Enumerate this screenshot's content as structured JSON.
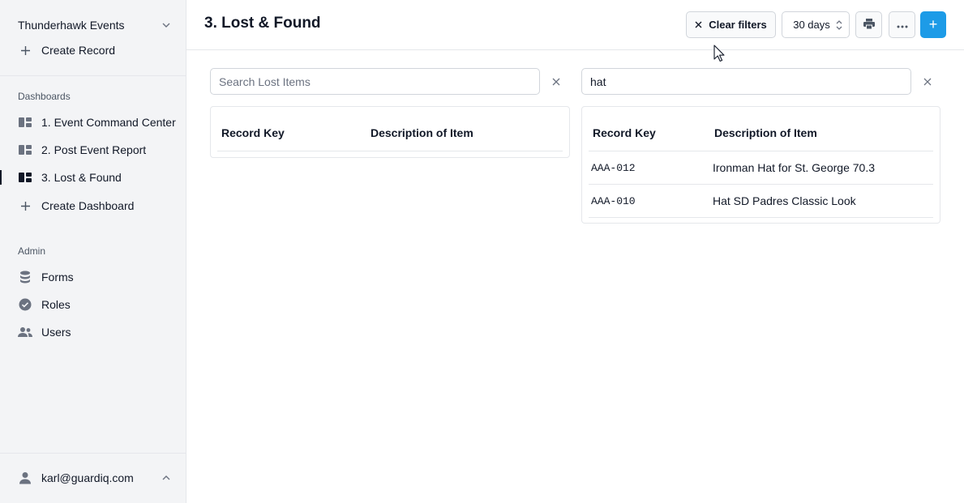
{
  "sidebar": {
    "org_name": "Thunderhawk Events",
    "create_record": "Create Record",
    "dashboards_label": "Dashboards",
    "dashboards": [
      {
        "label": "1. Event Command Center"
      },
      {
        "label": "2. Post Event Report"
      },
      {
        "label": "3. Lost & Found"
      }
    ],
    "create_dashboard": "Create Dashboard",
    "admin_label": "Admin",
    "admin_items": [
      {
        "label": "Forms",
        "icon": "database-icon"
      },
      {
        "label": "Roles",
        "icon": "check-badge-icon"
      },
      {
        "label": "Users",
        "icon": "users-icon"
      }
    ],
    "user_email": "karl@guardiq.com"
  },
  "header": {
    "title": "3. Lost & Found",
    "clear_filters": "Clear filters",
    "date_range": "30 days",
    "add_label": "+"
  },
  "colors": {
    "accent": "#1d9be7",
    "sidebar_bg": "#f3f4f6",
    "border": "#e5e7eb"
  },
  "left_panel": {
    "search_placeholder": "Search Lost Items",
    "search_value": "",
    "columns": [
      "Record Key",
      "Description of Item"
    ],
    "rows": []
  },
  "right_panel": {
    "search_placeholder": "",
    "search_value": "hat",
    "columns": [
      "Record Key",
      "Description of Item"
    ],
    "rows": [
      {
        "key": "AAA-012",
        "description": "Ironman Hat for St. George 70.3"
      },
      {
        "key": "AAA-010",
        "description": "Hat SD Padres Classic Look"
      }
    ]
  }
}
